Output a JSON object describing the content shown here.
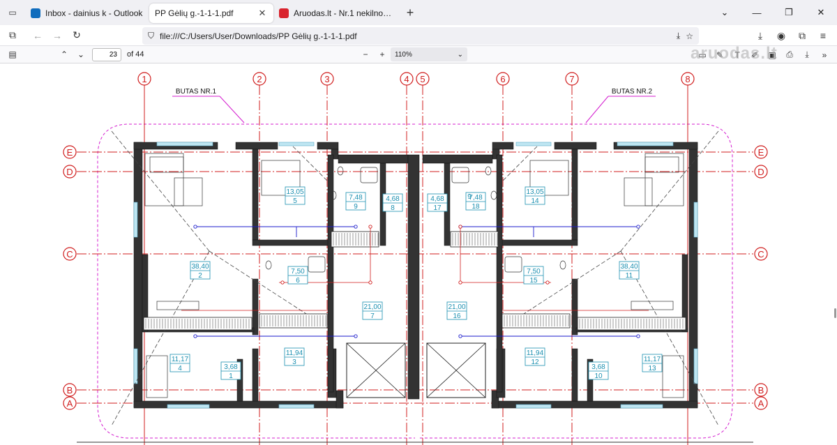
{
  "browser": {
    "tabs": [
      {
        "title": "Inbox - dainius k - Outlook",
        "favicon_color": "#0f6cbd",
        "active": false
      },
      {
        "title": "PP Gėlių g.-1-1-1.pdf",
        "favicon_color": "",
        "active": true
      },
      {
        "title": "Aruodas.lt - Nr.1 nekilnojamo tu",
        "favicon_color": "#d9232d",
        "active": false
      }
    ],
    "url": "file:///C:/Users/User/Downloads/PP Gėlių g.-1-1-1.pdf"
  },
  "pdf_toolbar": {
    "page_number": "23",
    "page_total": "of 44",
    "zoom": "110%"
  },
  "watermark": "aruodas.lt",
  "drawing": {
    "grid_columns": [
      "1",
      "2",
      "3",
      "4",
      "5",
      "6",
      "7",
      "8"
    ],
    "grid_rows": [
      "E",
      "D",
      "C",
      "B",
      "A"
    ],
    "unit_labels": [
      "BUTAS NR.1",
      "BUTAS NR.2"
    ],
    "rooms": [
      {
        "area": "13,05",
        "num": "5"
      },
      {
        "area": "7,48",
        "num": "9"
      },
      {
        "area": "4,68",
        "num": "8"
      },
      {
        "area": "4,68",
        "num": "17"
      },
      {
        "area": "7,48",
        "num": "18"
      },
      {
        "area": "13,05",
        "num": "14"
      },
      {
        "area": "38,40",
        "num": "2"
      },
      {
        "area": "7,50",
        "num": "6"
      },
      {
        "area": "21,00",
        "num": "7"
      },
      {
        "area": "21,00",
        "num": "16"
      },
      {
        "area": "7,50",
        "num": "15"
      },
      {
        "area": "38,40",
        "num": "11"
      },
      {
        "area": "11,17",
        "num": "4"
      },
      {
        "area": "3,68",
        "num": "1"
      },
      {
        "area": "11,94",
        "num": "3"
      },
      {
        "area": "11,94",
        "num": "12"
      },
      {
        "area": "3,68",
        "num": "10"
      },
      {
        "area": "11,17",
        "num": "13"
      }
    ],
    "extra_label": "9",
    "colors": {
      "grid": "#d01c1c",
      "boundary": "#d41ccf",
      "room_tag": "#1a8fb0",
      "wiring": "#1a1acc",
      "wall": "#333333"
    }
  }
}
